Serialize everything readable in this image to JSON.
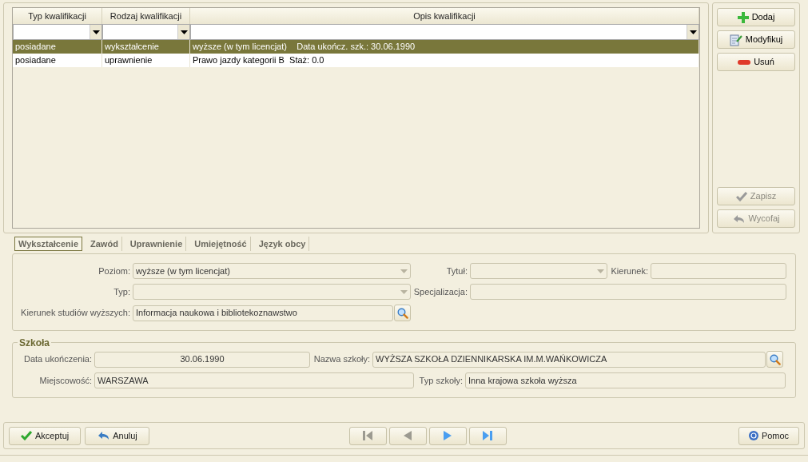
{
  "grid": {
    "columns": [
      "Typ kwalifikacji",
      "Rodzaj kwalifikacji",
      "Opis kwalifikacji"
    ],
    "rows": [
      {
        "cells": [
          "posiadane",
          "wykształcenie",
          "wyższe (w tym licencjat)    Data ukończ. szk.: 30.06.1990"
        ],
        "selected": true
      },
      {
        "cells": [
          "posiadane",
          "uprawnienie",
          "Prawo jazdy kategorii B  Staż: 0.0"
        ],
        "selected": false
      }
    ]
  },
  "side_buttons": [
    {
      "label": "Dodaj",
      "disabled": false
    },
    {
      "label": "Modyfikuj",
      "disabled": false
    },
    {
      "label": "Usuń",
      "disabled": false
    },
    {
      "label": "Zapisz",
      "disabled": true
    },
    {
      "label": "Wycofaj",
      "disabled": true
    }
  ],
  "tabs": [
    {
      "label": "Wykształcenie",
      "selected": true
    },
    {
      "label": "Zawód",
      "selected": false
    },
    {
      "label": "Uprawnienie",
      "selected": false
    },
    {
      "label": "Umiejętność",
      "selected": false
    },
    {
      "label": "Język obcy",
      "selected": false
    }
  ],
  "education": [
    [
      {
        "kind": "select",
        "label": "Poziom:",
        "value": "wyższe (w tym licencjat)"
      },
      {
        "kind": "select",
        "label": "Tytuł:"
      },
      {
        "kind": "text",
        "label": "Kierunek:"
      }
    ],
    [
      {
        "kind": "select",
        "label": "Typ:"
      },
      {
        "kind": "text",
        "label": "Specjalizacja:"
      }
    ],
    [
      {
        "kind": "lookup",
        "label": "Kierunek studiów wyższych:",
        "value": "Informacja naukowa i bibliotekoznawstwo"
      }
    ]
  ],
  "school": {
    "title": "Szkoła",
    "rows": [
      [
        {
          "kind": "date",
          "label": "Data ukończenia:",
          "value": "30.06.1990"
        },
        {
          "kind": "lookup",
          "label": "Nazwa szkoły:",
          "value": "WYŻSZA SZKOŁA DZIENNIKARSKA IM.M.WAŃKOWICZA"
        }
      ],
      [
        {
          "kind": "text",
          "label": "Miejscowość:",
          "value": "WARSZAWA"
        },
        {
          "kind": "text",
          "label": "Typ szkoły:",
          "value": "Inna krajowa szkoła wyższa"
        }
      ]
    ]
  },
  "bottom_buttons": [
    {
      "label": "Akceptuj"
    },
    {
      "label": "Anuluj"
    }
  ],
  "nav_buttons": [
    {
      "disabled": true
    },
    {
      "disabled": true
    },
    {
      "disabled": false
    },
    {
      "disabled": false
    }
  ],
  "help_button": {
    "label": "Pomoc"
  }
}
